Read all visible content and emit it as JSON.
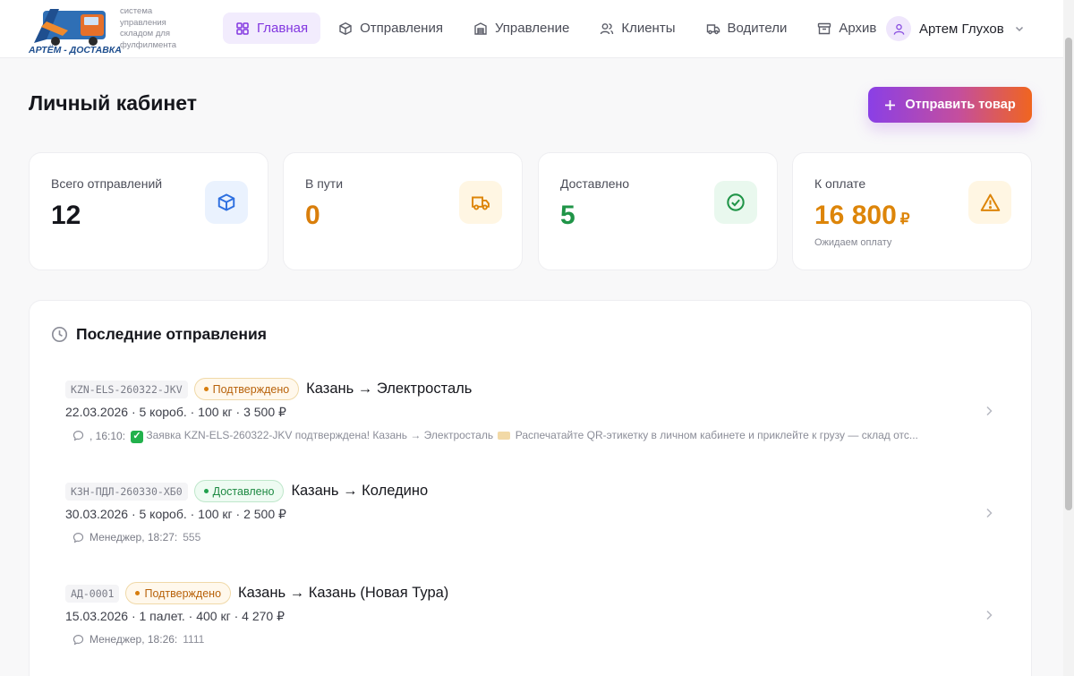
{
  "brand": {
    "logo_text": "АРТЁМ - ДОСТАВКА",
    "tagline": "система управления складом для фулфилмента"
  },
  "nav": [
    {
      "label": "Главная",
      "icon": "grid-icon",
      "active": true
    },
    {
      "label": "Отправления",
      "icon": "box-icon",
      "active": false
    },
    {
      "label": "Управление",
      "icon": "warehouse-icon",
      "active": false
    },
    {
      "label": "Клиенты",
      "icon": "users-icon",
      "active": false
    },
    {
      "label": "Водители",
      "icon": "truck-icon",
      "active": false
    },
    {
      "label": "Архив",
      "icon": "archive-icon",
      "active": false
    }
  ],
  "user": {
    "name": "Артем Глухов"
  },
  "page": {
    "title": "Личный кабинет",
    "send_button": "Отправить товар"
  },
  "stats": [
    {
      "label": "Всего отправлений",
      "value": "12",
      "color": "#15161c",
      "icon": "box-icon"
    },
    {
      "label": "В пути",
      "value": "0",
      "color": "#d97e0b",
      "icon": "truck-icon"
    },
    {
      "label": "Доставлено",
      "value": "5",
      "color": "#1f9447",
      "icon": "check-circle-icon"
    },
    {
      "label": "К оплате",
      "value": "16 800",
      "currency": "₽",
      "sub": "Ожидаем оплату",
      "color": "#dd8509",
      "icon": "warning-icon"
    }
  ],
  "recent": {
    "title": "Последние отправления",
    "items": [
      {
        "code": "KZN-ELS-260322-JKV",
        "status": "Подтверждено",
        "route": "Казань → Электросталь",
        "meta": "22.03.2026 · 5 короб. · 100 кг · 3 500 ₽",
        "comment_who": ", 16:10:",
        "comment_part1": "Заявка KZN-ELS-260322-JKV подтверждена! Казань → Электросталь",
        "comment_part2": "Распечатайте QR-этикетку в личном кабинете и приклейте к грузу — склад отс..."
      },
      {
        "code": "КЗН-ПДЛ-260330-ХБ0",
        "status": "Доставлено",
        "route": "Казань → Коледино",
        "meta": "30.03.2026 · 5 короб. · 100 кг · 2 500 ₽",
        "comment_who": "Менеджер, 18:27:",
        "comment_text": "555"
      },
      {
        "code": "АД-0001",
        "status": "Подтверждено",
        "route": "Казань → Казань (Новая Тура)",
        "meta": "15.03.2026 · 1 палет. · 400 кг · 4 270 ₽",
        "comment_who": "Менеджер, 18:26:",
        "comment_text": "1111"
      }
    ]
  }
}
